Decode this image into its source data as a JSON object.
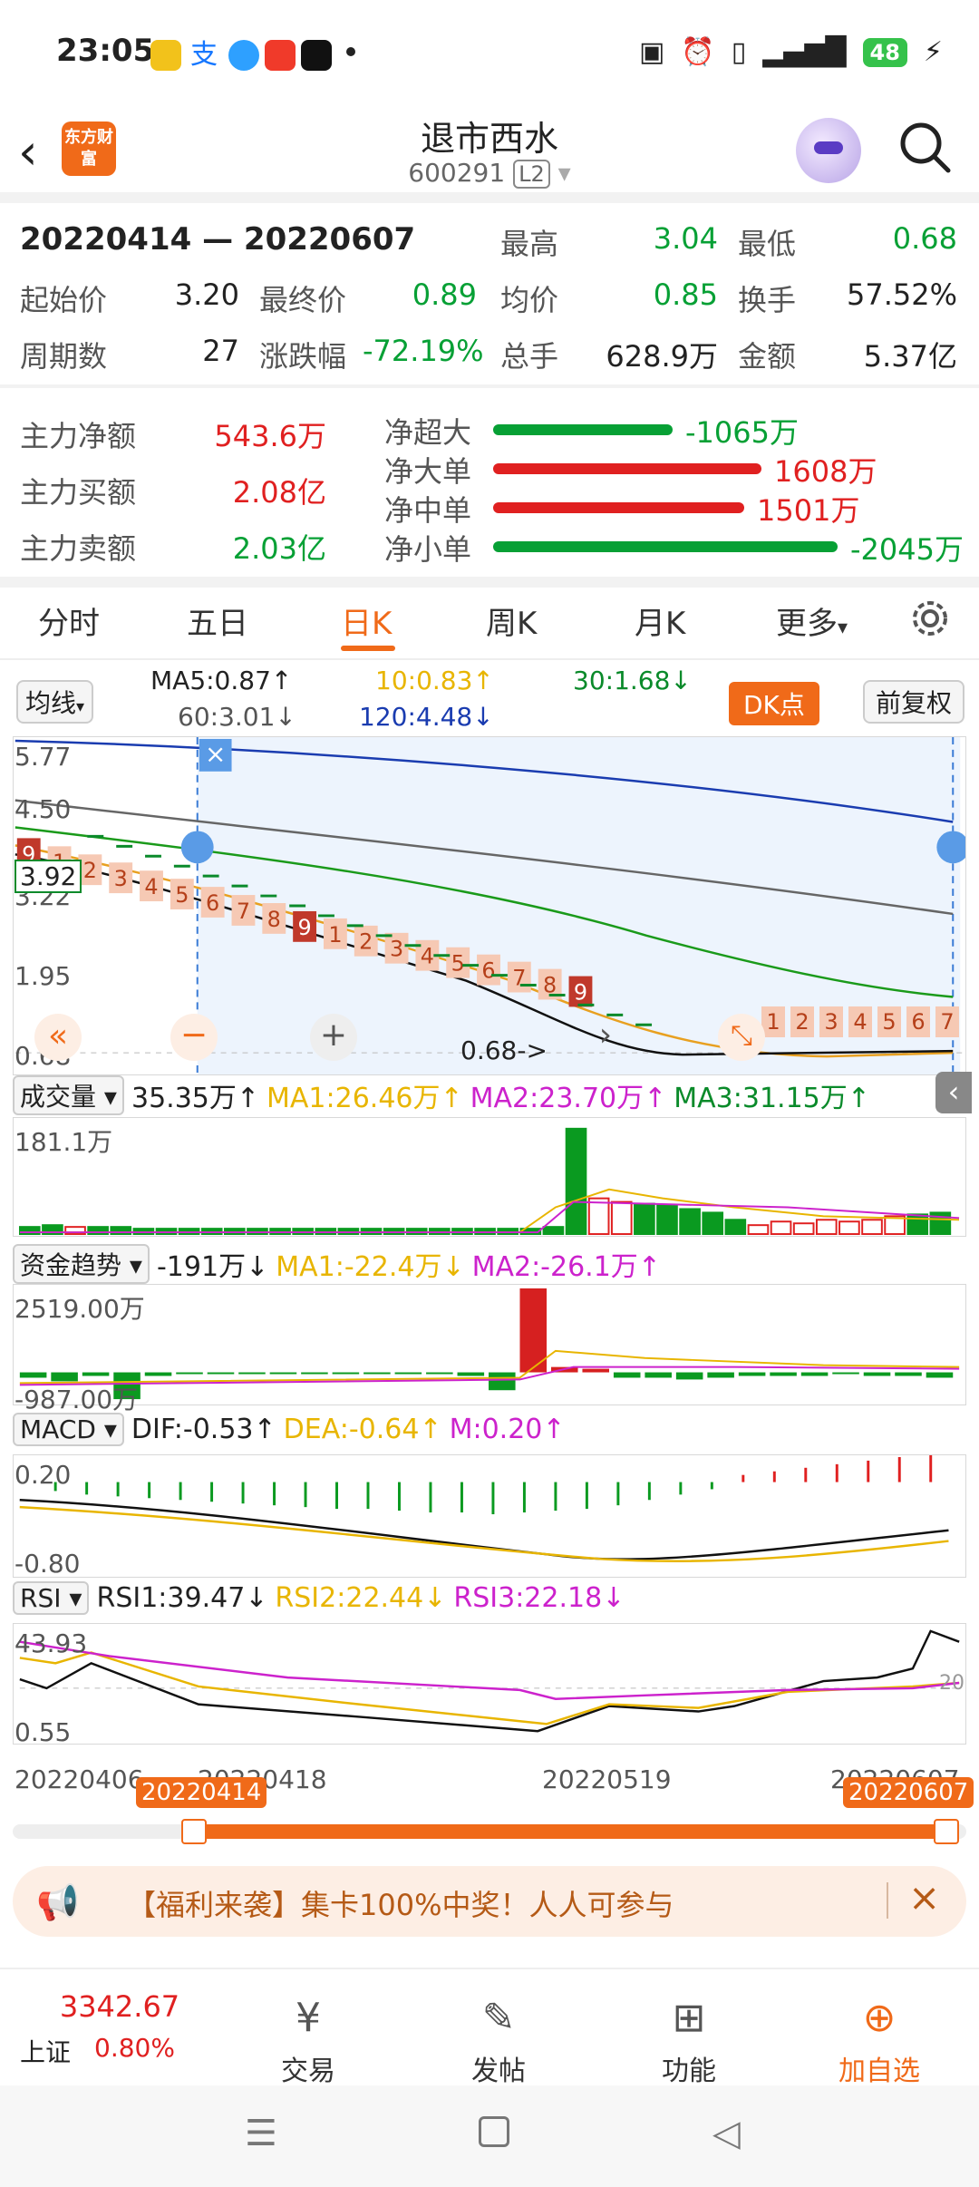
{
  "status_bar": {
    "time": "23:05",
    "icons": [
      "weibo-icon",
      "alipay-icon",
      "browser-icon",
      "video-icon",
      "tiktok-icon",
      "dot-icon"
    ],
    "right_icons": [
      "nfc-icon",
      "alarm-icon",
      "vibrate-icon",
      "5g-signal-icon"
    ],
    "battery": "48"
  },
  "header": {
    "back_icon": "back-arrow-icon",
    "logo_text": "东方财富",
    "title": "退市西水",
    "code": "600291",
    "level": "L2",
    "search_icon": "search-icon"
  },
  "summary": {
    "range": "20220414 — 20220607",
    "high_label": "最高",
    "high": "3.04",
    "low_label": "最低",
    "low": "0.68",
    "open_label": "起始价",
    "open": "3.20",
    "close_label": "最终价",
    "close": "0.89",
    "avg_label": "均价",
    "avg": "0.85",
    "turnover_label": "换手",
    "turnover": "57.52%",
    "periods_label": "周期数",
    "periods": "27",
    "change_label": "涨跌幅",
    "change": "-72.19%",
    "volume_label": "总手",
    "volume": "628.9万",
    "amount_label": "金额",
    "amount": "5.37亿"
  },
  "main_flow": {
    "net_label": "主力净额",
    "net": "543.6万",
    "buy_label": "主力买额",
    "buy": "2.08亿",
    "sell_label": "主力卖额",
    "sell": "2.03亿",
    "bars": [
      {
        "label": "净超大",
        "value": "-1065万",
        "fraction": 0.52,
        "color": "#07a035"
      },
      {
        "label": "净大单",
        "value": "1608万",
        "fraction": 0.78,
        "color": "#e02020"
      },
      {
        "label": "净中单",
        "value": "1501万",
        "fraction": 0.73,
        "color": "#e02020"
      },
      {
        "label": "净小单",
        "value": "-2045万",
        "fraction": 1.0,
        "color": "#07a035"
      }
    ]
  },
  "tabs": [
    "分时",
    "五日",
    "日K",
    "周K",
    "月K",
    "更多"
  ],
  "active_tab": "日K",
  "settings_icon": "gear-icon",
  "ma": {
    "selector": "均线",
    "ma5": "MA5:0.87↑",
    "ma10": "10:0.83↑",
    "ma30": "30:1.68↓",
    "ma60": "60:3.01↓",
    "ma120": "120:4.48↓",
    "dk_label": "DK点",
    "adjust_label": "前复权"
  },
  "kline": {
    "price_labels": [
      "5.77",
      "4.50",
      "3.22",
      "1.95",
      "0.68"
    ],
    "last_close_tag": "3.92",
    "low_tag": "0.68->",
    "seq_left": [
      "9",
      "1",
      "2",
      "3",
      "4",
      "5",
      "6",
      "7",
      "8",
      "9",
      "1",
      "2",
      "3",
      "4",
      "5",
      "6",
      "7",
      "8",
      "9"
    ],
    "seq_right": [
      "1",
      "2",
      "3",
      "4",
      "5",
      "6",
      "7"
    ],
    "close_icon": "close-icon",
    "rewind_icon": "double-left-arrow-icon",
    "zoom_out_icon": "minus-icon",
    "zoom_in_icon": "plus-icon",
    "next_icon": "chevron-right-icon",
    "expand_icon": "expand-icon"
  },
  "volume_ind": {
    "selector": "成交量",
    "value": "35.35万↑",
    "ma1": "MA1:26.46万↑",
    "ma2": "MA2:23.70万↑",
    "ma3": "MA3:31.15万↑",
    "top_label": "181.1万",
    "collapse_icon": "chevron-left-icon"
  },
  "fund_ind": {
    "selector": "资金趋势",
    "value": "-191万↓",
    "ma1": "MA1:-22.4万↓",
    "ma2": "MA2:-26.1万↑",
    "top_label": "2519.00万",
    "bottom_label": "-987.00万"
  },
  "macd_ind": {
    "selector": "MACD",
    "dif": "DIF:-0.53↑",
    "dea": "DEA:-0.64↑",
    "m": "M:0.20↑",
    "top_label": "0.20",
    "bottom_label": "-0.80"
  },
  "rsi_ind": {
    "selector": "RSI",
    "rsi1": "RSI1:39.47↓",
    "rsi2": "RSI2:22.44↓",
    "rsi3": "RSI3:22.18↓",
    "top_label": "43.93",
    "bottom_label": "0.55",
    "right_label": "20"
  },
  "dates": {
    "d1": "20220406",
    "d2": "20220418",
    "d3": "20220519",
    "d4": "20220607",
    "range_start": "20220414",
    "range_end": "20220607"
  },
  "promo": {
    "icon": "megaphone-icon",
    "text": "【福利来袭】集卡100%中奖！人人可参与",
    "close_icon": "close-icon"
  },
  "bottom_nav": {
    "index_value": "3342.67",
    "index_name": "上证",
    "index_change": "0.80%",
    "items": [
      {
        "label": "交易",
        "icon": "yen-circle-icon"
      },
      {
        "label": "发帖",
        "icon": "edit-icon"
      },
      {
        "label": "功能",
        "icon": "grid-icon"
      },
      {
        "label": "加自选",
        "icon": "plus-circle-icon"
      }
    ]
  },
  "system_nav": [
    "menu-icon",
    "home-icon",
    "back-icon"
  ]
}
